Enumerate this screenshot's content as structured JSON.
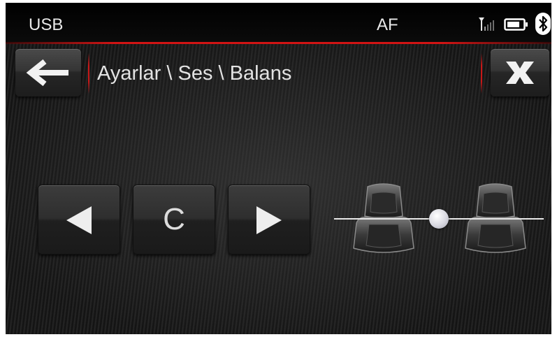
{
  "status_bar": {
    "source_label": "USB",
    "af_label": "AF",
    "accent_color": "#d11414"
  },
  "header": {
    "breadcrumb": "Ayarlar \\ Ses \\ Balans",
    "back_icon": "arrow-left-icon",
    "close_icon": "close-x-icon"
  },
  "controls": {
    "left_icon": "triangle-left-icon",
    "center_label": "C",
    "right_icon": "triangle-right-icon"
  },
  "balance": {
    "level": 0.5
  }
}
